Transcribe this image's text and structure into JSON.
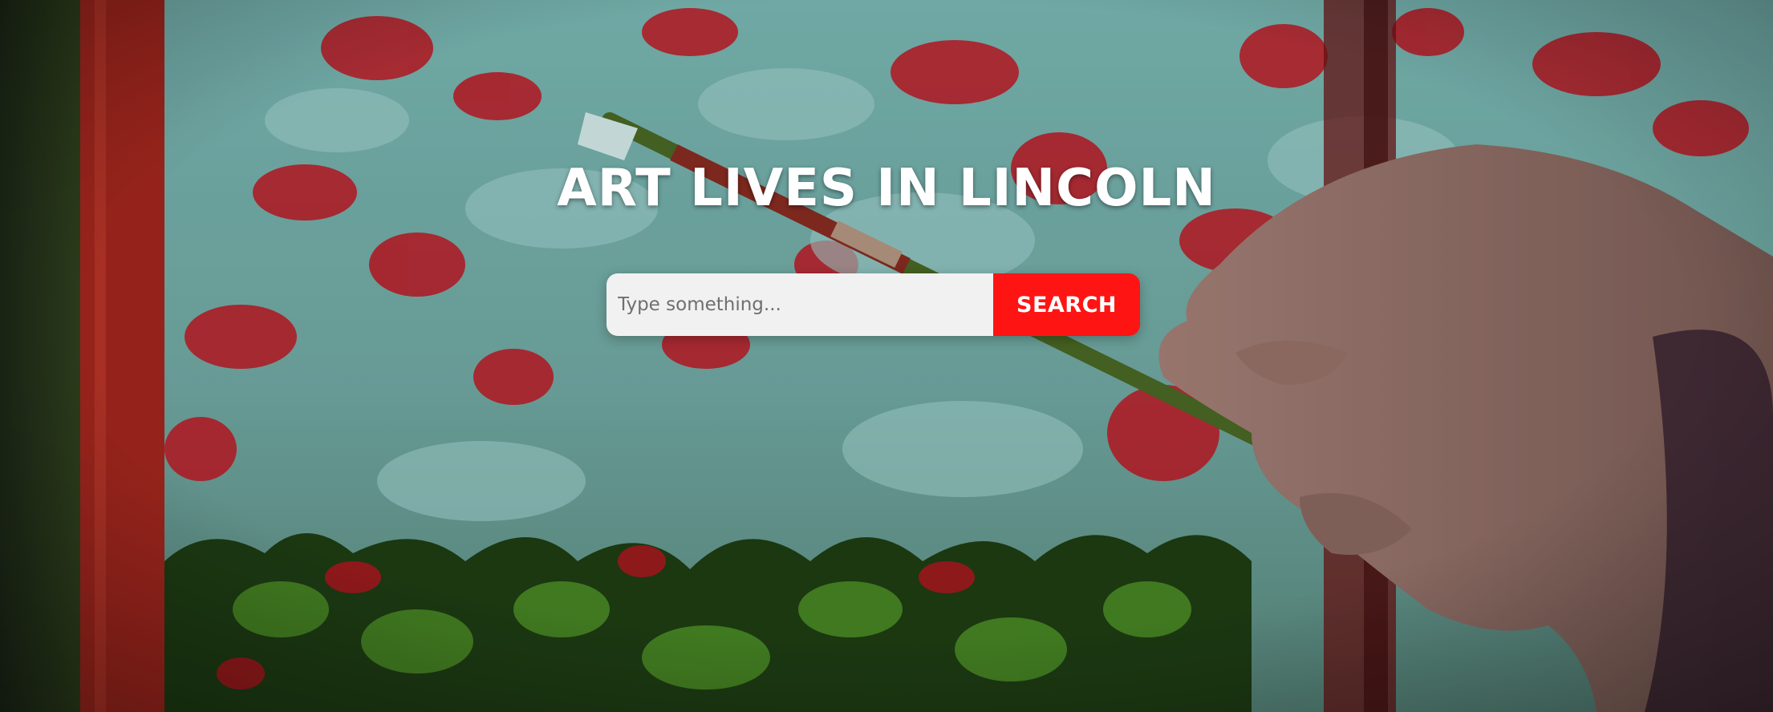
{
  "hero": {
    "title": "ART LIVES IN LINCOLN",
    "background_description_icon": "painting-hand-icon"
  },
  "search": {
    "placeholder": "Type something...",
    "value": "",
    "button_label": "SEARCH"
  },
  "colors": {
    "button_red": "#ff1414",
    "input_bg": "#f1f1f1",
    "title_text": "#ffffff",
    "canvas_teal": "#6fb3b0",
    "paint_red": "#c81420",
    "foliage_green": "#3f7d26"
  }
}
